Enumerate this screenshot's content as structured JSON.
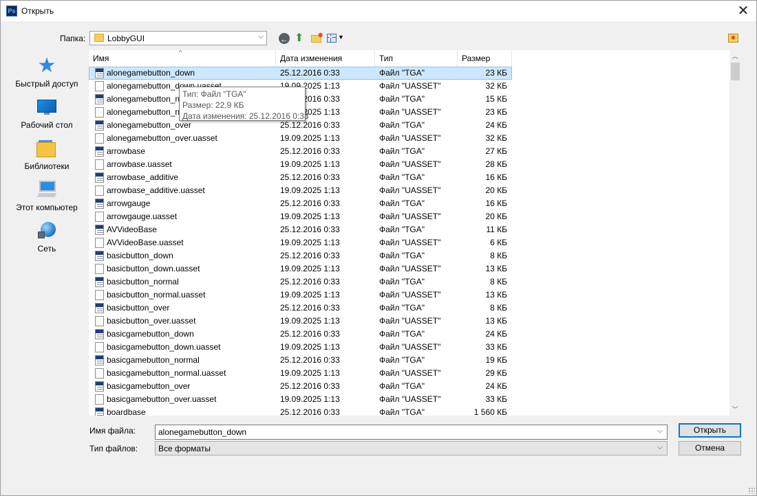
{
  "window": {
    "title": "Открыть",
    "app_icon_text": "Ps",
    "close_glyph": "✕"
  },
  "toolbar": {
    "folder_label": "Папка:",
    "current_folder": "LobbyGUI",
    "icons": [
      "back-icon",
      "up-folder-icon",
      "new-folder-icon",
      "view-menu-icon",
      "favorite-icon"
    ]
  },
  "sidebar": {
    "items": [
      {
        "label": "Быстрый доступ",
        "icon": "star-icon"
      },
      {
        "label": "Рабочий стол",
        "icon": "desktop-icon"
      },
      {
        "label": "Библиотеки",
        "icon": "libraries-icon"
      },
      {
        "label": "Этот компьютер",
        "icon": "computer-icon"
      },
      {
        "label": "Сеть",
        "icon": "network-icon"
      }
    ]
  },
  "list": {
    "columns": {
      "name": "Имя",
      "date": "Дата изменения",
      "type": "Тип",
      "size": "Размер"
    },
    "selected_index": 0,
    "rows": [
      {
        "name": "alonegamebutton_down",
        "date": "25.12.2016 0:33",
        "type": "Файл \"TGA\"",
        "size": "23 КБ",
        "kind": "tga"
      },
      {
        "name": "alonegamebutton_down.uasset",
        "date": "19.09.2025 1:13",
        "type": "Файл \"UASSET\"",
        "size": "32 КБ",
        "kind": "doc"
      },
      {
        "name": "alonegamebutton_normal",
        "date": "25.12.2016 0:33",
        "type": "Файл \"TGA\"",
        "size": "15 КБ",
        "kind": "tga"
      },
      {
        "name": "alonegamebutton_normal.uasset",
        "date": "19.09.2025 1:13",
        "type": "Файл \"UASSET\"",
        "size": "23 КБ",
        "kind": "doc"
      },
      {
        "name": "alonegamebutton_over",
        "date": "25.12.2016 0:33",
        "type": "Файл \"TGA\"",
        "size": "24 КБ",
        "kind": "tga"
      },
      {
        "name": "alonegamebutton_over.uasset",
        "date": "19.09.2025 1:13",
        "type": "Файл \"UASSET\"",
        "size": "32 КБ",
        "kind": "doc"
      },
      {
        "name": "arrowbase",
        "date": "25.12.2016 0:33",
        "type": "Файл \"TGA\"",
        "size": "27 КБ",
        "kind": "tga"
      },
      {
        "name": "arrowbase.uasset",
        "date": "19.09.2025 1:13",
        "type": "Файл \"UASSET\"",
        "size": "28 КБ",
        "kind": "doc"
      },
      {
        "name": "arrowbase_additive",
        "date": "25.12.2016 0:33",
        "type": "Файл \"TGA\"",
        "size": "16 КБ",
        "kind": "tga"
      },
      {
        "name": "arrowbase_additive.uasset",
        "date": "19.09.2025 1:13",
        "type": "Файл \"UASSET\"",
        "size": "20 КБ",
        "kind": "doc"
      },
      {
        "name": "arrowgauge",
        "date": "25.12.2016 0:33",
        "type": "Файл \"TGA\"",
        "size": "16 КБ",
        "kind": "tga"
      },
      {
        "name": "arrowgauge.uasset",
        "date": "19.09.2025 1:13",
        "type": "Файл \"UASSET\"",
        "size": "20 КБ",
        "kind": "doc"
      },
      {
        "name": "AVVideoBase",
        "date": "25.12.2016 0:33",
        "type": "Файл \"TGA\"",
        "size": "11 КБ",
        "kind": "tga"
      },
      {
        "name": "AVVideoBase.uasset",
        "date": "19.09.2025 1:13",
        "type": "Файл \"UASSET\"",
        "size": "6 КБ",
        "kind": "doc"
      },
      {
        "name": "basicbutton_down",
        "date": "25.12.2016 0:33",
        "type": "Файл \"TGA\"",
        "size": "8 КБ",
        "kind": "tga"
      },
      {
        "name": "basicbutton_down.uasset",
        "date": "19.09.2025 1:13",
        "type": "Файл \"UASSET\"",
        "size": "13 КБ",
        "kind": "doc"
      },
      {
        "name": "basicbutton_normal",
        "date": "25.12.2016 0:33",
        "type": "Файл \"TGA\"",
        "size": "8 КБ",
        "kind": "tga"
      },
      {
        "name": "basicbutton_normal.uasset",
        "date": "19.09.2025 1:13",
        "type": "Файл \"UASSET\"",
        "size": "13 КБ",
        "kind": "doc"
      },
      {
        "name": "basicbutton_over",
        "date": "25.12.2016 0:33",
        "type": "Файл \"TGA\"",
        "size": "8 КБ",
        "kind": "tga"
      },
      {
        "name": "basicbutton_over.uasset",
        "date": "19.09.2025 1:13",
        "type": "Файл \"UASSET\"",
        "size": "13 КБ",
        "kind": "doc"
      },
      {
        "name": "basicgamebutton_down",
        "date": "25.12.2016 0:33",
        "type": "Файл \"TGA\"",
        "size": "24 КБ",
        "kind": "tga"
      },
      {
        "name": "basicgamebutton_down.uasset",
        "date": "19.09.2025 1:13",
        "type": "Файл \"UASSET\"",
        "size": "33 КБ",
        "kind": "doc"
      },
      {
        "name": "basicgamebutton_normal",
        "date": "25.12.2016 0:33",
        "type": "Файл \"TGA\"",
        "size": "19 КБ",
        "kind": "tga"
      },
      {
        "name": "basicgamebutton_normal.uasset",
        "date": "19.09.2025 1:13",
        "type": "Файл \"UASSET\"",
        "size": "29 КБ",
        "kind": "doc"
      },
      {
        "name": "basicgamebutton_over",
        "date": "25.12.2016 0:33",
        "type": "Файл \"TGA\"",
        "size": "24 КБ",
        "kind": "tga"
      },
      {
        "name": "basicgamebutton_over.uasset",
        "date": "19.09.2025 1:13",
        "type": "Файл \"UASSET\"",
        "size": "33 КБ",
        "kind": "doc"
      },
      {
        "name": "boardbase",
        "date": "25.12.2016 0:33",
        "type": "Файл \"TGA\"",
        "size": "1 560 КБ",
        "kind": "tga"
      }
    ]
  },
  "tooltip": {
    "type_line": "Тип: Файл \"TGA\"",
    "size_line": "Размер: 22,9 КБ",
    "date_line": "Дата изменения: 25.12.2016 0:33"
  },
  "bottom": {
    "filename_label": "Имя файла:",
    "filename_value": "alonegamebutton_down",
    "filetype_label": "Тип файлов:",
    "filetype_value": "Все форматы",
    "open_label": "Открыть",
    "cancel_label": "Отмена"
  }
}
